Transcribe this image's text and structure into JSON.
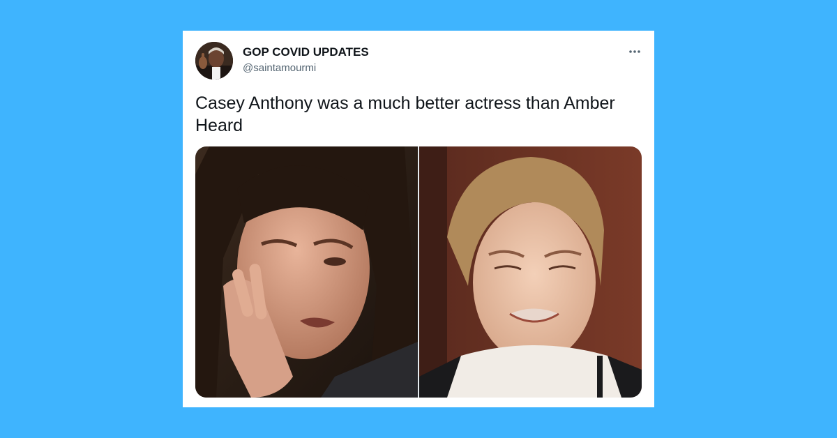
{
  "tweet": {
    "author_name": "GOP COVID UPDATES",
    "author_handle": "@saintamourmi",
    "text": "Casey Anthony was a much better actress than Amber Heard",
    "more_icon": "more-horizontal-icon"
  },
  "media": {
    "count": 2
  },
  "colors": {
    "background": "#3fb4fe",
    "card": "#ffffff",
    "name_text": "#0f1419",
    "handle_text": "#536471"
  }
}
